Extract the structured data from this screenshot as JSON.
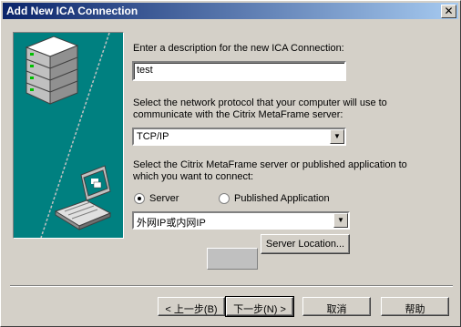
{
  "window": {
    "title": "Add New ICA Connection",
    "close_label": "✕"
  },
  "description": {
    "label": "Enter a description for the new ICA Connection:",
    "value": "test"
  },
  "protocol": {
    "label_line1": "Select the network protocol that your computer will use to",
    "label_line2": "communicate with the Citrix MetaFrame server:",
    "selected": "TCP/IP"
  },
  "server": {
    "label_line1": "Select the Citrix MetaFrame server or published application to",
    "label_line2": "which you want to connect:",
    "radio_server": "Server",
    "radio_published": "Published Application",
    "selected_radio": "server",
    "selected_value": "外网IP或内网IP",
    "location_button": "Server Location..."
  },
  "buttons": {
    "back": "< 上一步(B)",
    "next": "下一步(N) >",
    "cancel": "取消",
    "help": "帮助"
  },
  "colors": {
    "illustration_bg": "#008080",
    "title_start": "#0a246a",
    "title_end": "#a6caf0"
  },
  "icons": [
    "server-stack-icon",
    "laptop-icon",
    "close-icon",
    "dropdown-arrow-icon"
  ]
}
